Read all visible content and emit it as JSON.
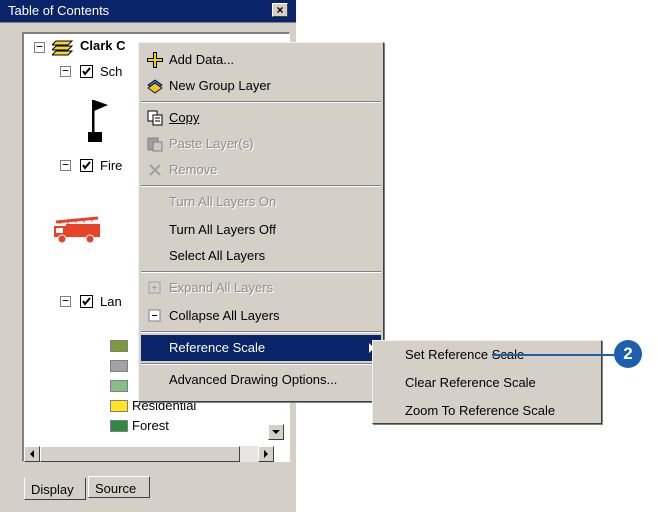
{
  "toc": {
    "title": "Table of Contents",
    "close_glyph": "×",
    "tree": {
      "root_label": "Clark C",
      "layer_school": "Sch",
      "layer_fire": "Fire",
      "layer_land": "Lan",
      "legend_residential": "Residential",
      "legend_forest": "Forest"
    },
    "tabs": {
      "display": "Display",
      "source": "Source"
    }
  },
  "context_menu": {
    "add_data": "Add Data...",
    "new_group_layer": "New Group Layer",
    "copy": "Copy",
    "paste_layers": "Paste Layer(s)",
    "remove": "Remove",
    "turn_all_on": "Turn All Layers On",
    "turn_all_off": "Turn All Layers Off",
    "select_all": "Select All Layers",
    "expand_all": "Expand All Layers",
    "collapse_all": "Collapse All Layers",
    "reference_scale": "Reference Scale",
    "advanced_drawing": "Advanced Drawing Options..."
  },
  "submenu": {
    "set_reference_scale": "Set Reference Scale",
    "clear_reference_scale": "Clear Reference Scale",
    "zoom_to_reference_scale": "Zoom To Reference Scale"
  },
  "callout": {
    "number": "2"
  },
  "colors": {
    "title_bar": "#0a246a",
    "menu_highlight": "#0a246a",
    "callout": "#1c5fae",
    "legend": [
      "#7d9a3c",
      "#a3a3a3",
      "#86c086",
      "#ffe51f",
      "#2e8b3e"
    ],
    "fire_truck": "#e8432a"
  }
}
